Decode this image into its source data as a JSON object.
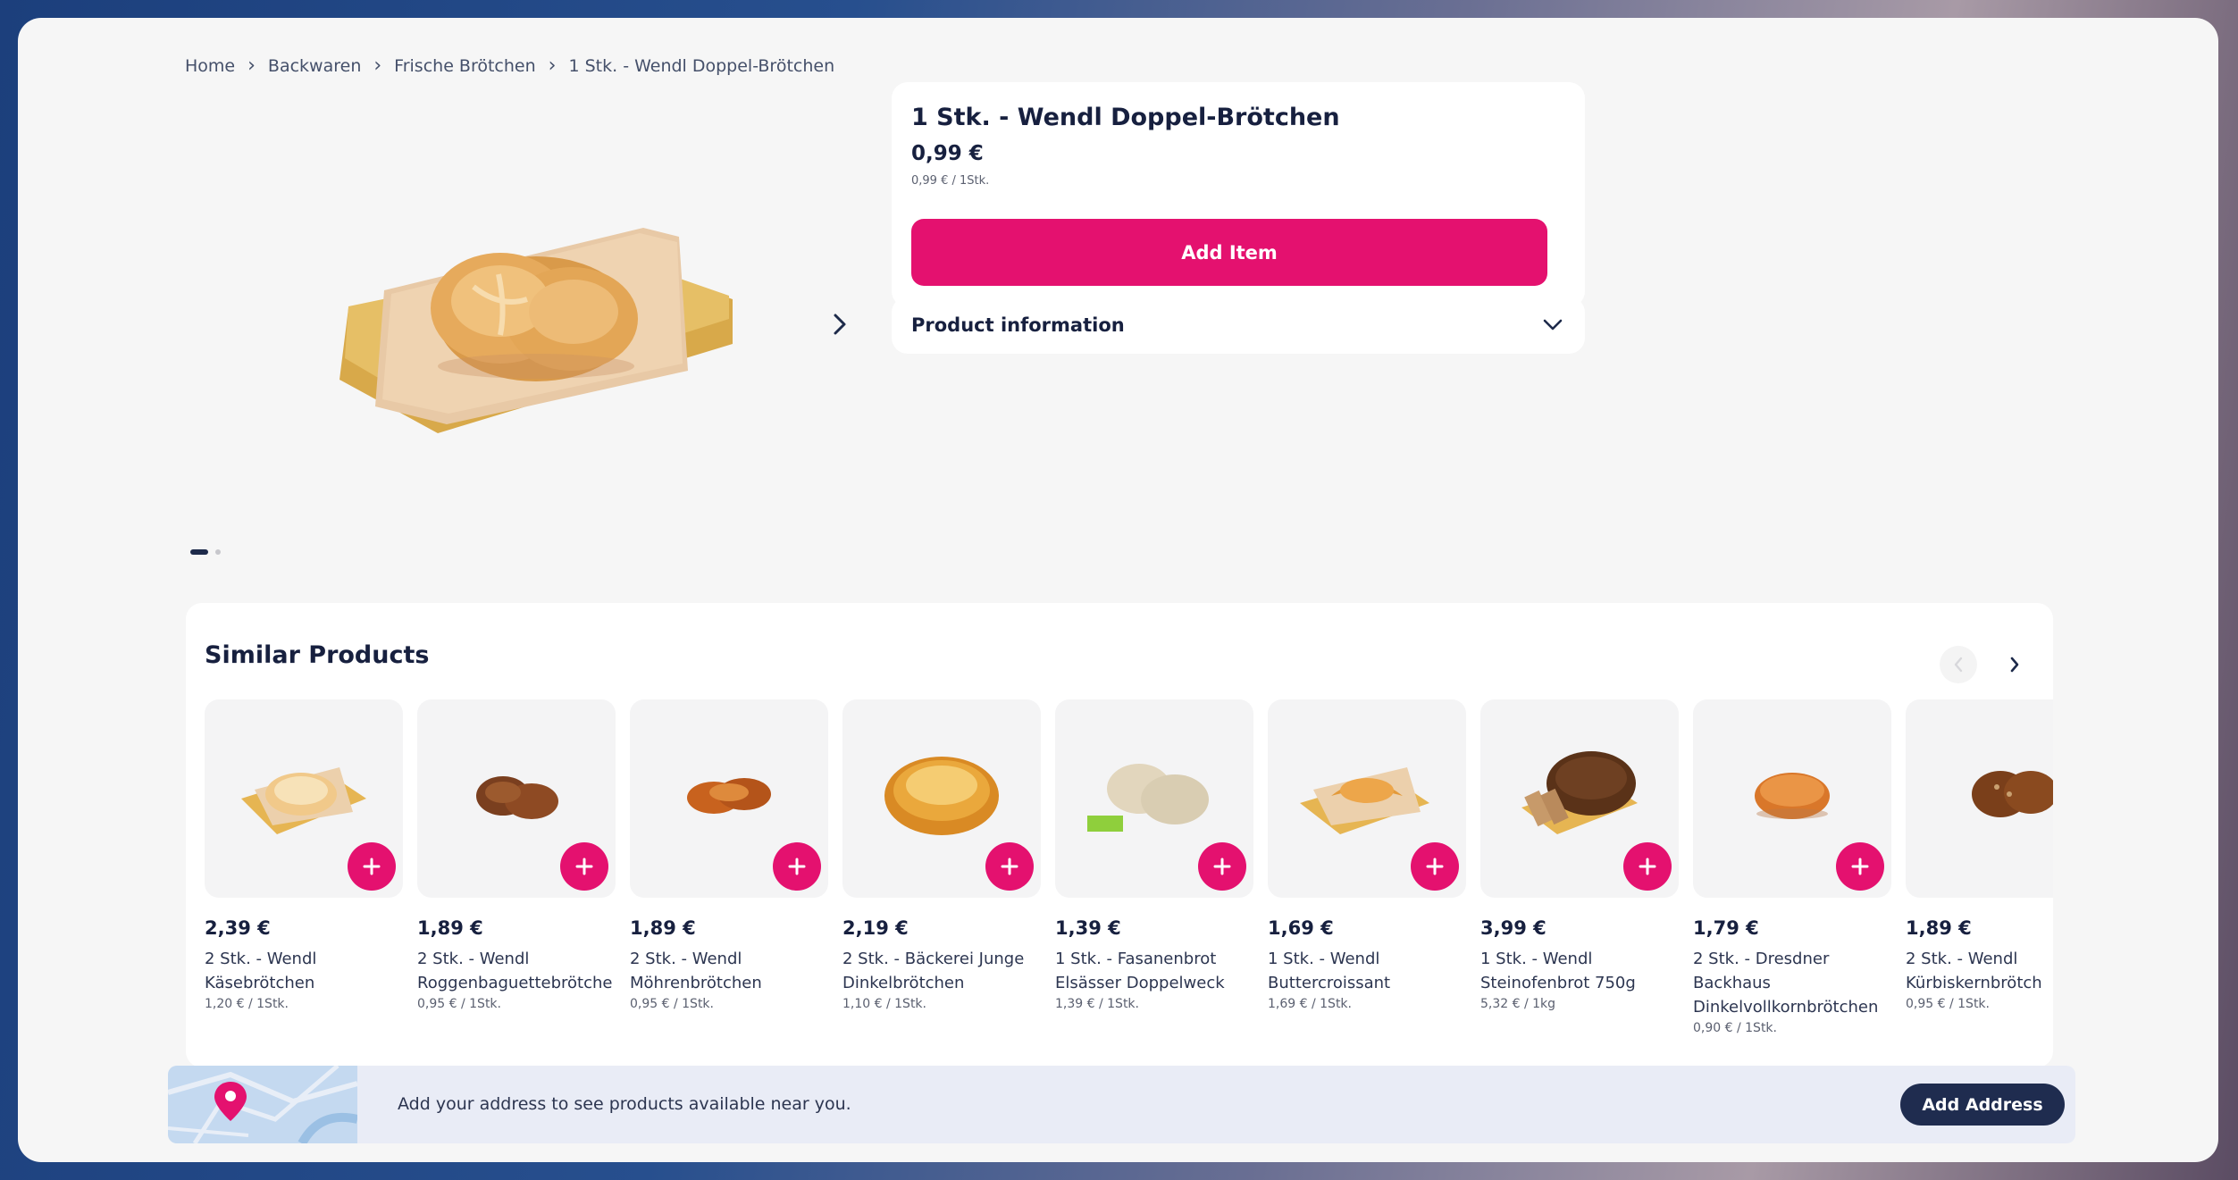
{
  "breadcrumb": {
    "items": [
      "Home",
      "Backwaren",
      "Frische Brötchen",
      "1 Stk. - Wendl Doppel-Brötchen"
    ],
    "separator": ">"
  },
  "product": {
    "title": "1 Stk. - Wendl Doppel-Brötchen",
    "price": "0,99 €",
    "unit_price": "0,99 € / 1Stk.",
    "add_label": "Add Item",
    "info_label": "Product information",
    "gallery": {
      "current": 1,
      "total": 2
    }
  },
  "similar": {
    "title": "Similar Products",
    "items": [
      {
        "price": "2,39 €",
        "line1": "2 Stk. - Wendl",
        "line2": "Käsebrötchen",
        "line3": "",
        "unit": "1,20 € / 1Stk."
      },
      {
        "price": "1,89 €",
        "line1": "2 Stk. - Wendl",
        "line2": "Roggenbaguettebrötche",
        "line3": "",
        "unit": "0,95 € / 1Stk."
      },
      {
        "price": "1,89 €",
        "line1": "2 Stk. - Wendl",
        "line2": "Möhrenbrötchen",
        "line3": "",
        "unit": "0,95 € / 1Stk."
      },
      {
        "price": "2,19 €",
        "line1": "2 Stk. - Bäckerei Junge",
        "line2": "Dinkelbrötchen",
        "line3": "",
        "unit": "1,10 € / 1Stk."
      },
      {
        "price": "1,39 €",
        "line1": "1 Stk. - Fasanenbrot",
        "line2": "Elsässer Doppelweck",
        "line3": "",
        "unit": "1,39 € / 1Stk."
      },
      {
        "price": "1,69 €",
        "line1": "1 Stk. - Wendl",
        "line2": "Buttercroissant",
        "line3": "",
        "unit": "1,69 € / 1Stk."
      },
      {
        "price": "3,99 €",
        "line1": "1 Stk. - Wendl",
        "line2": "Steinofenbrot 750g",
        "line3": "",
        "unit": "5,32 € / 1kg"
      },
      {
        "price": "1,79 €",
        "line1": "2 Stk. - Dresdner",
        "line2": "Backhaus",
        "line3": "Dinkelvollkornbrötchen",
        "unit": "0,90 € / 1Stk."
      },
      {
        "price": "1,89 €",
        "line1": "2 Stk. - Wendl",
        "line2": "Kürbiskernbrötch",
        "line3": "",
        "unit": "0,95 € / 1Stk."
      }
    ]
  },
  "address": {
    "text": "Add your address to see products available near you.",
    "button_label": "Add Address"
  },
  "colors": {
    "accent": "#e4116f",
    "navy": "#1f2c4f",
    "background": "#f6f6f6"
  },
  "icons": [
    "chevron-right-icon",
    "chevron-down-icon",
    "chevron-left-icon",
    "plus-icon",
    "location-pin-icon"
  ]
}
